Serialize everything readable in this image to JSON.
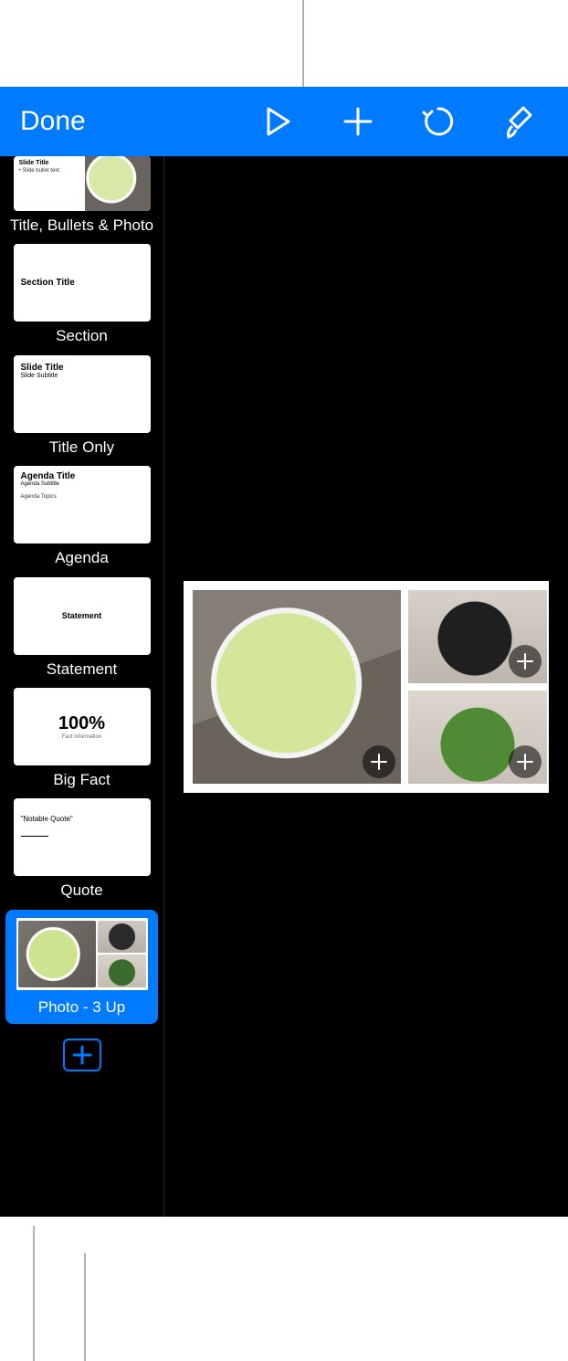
{
  "toolbar": {
    "done_label": "Done",
    "icons": {
      "play": "play-icon",
      "add": "plus-icon",
      "undo": "undo-icon",
      "format": "paintbrush-icon"
    }
  },
  "navigator": {
    "items": [
      {
        "label": "Title, Bullets & Photo",
        "template": "title-bullets-photo",
        "heading": "Slide Title",
        "body": "Slide bullet text"
      },
      {
        "label": "Section",
        "template": "section",
        "heading": "Section Title"
      },
      {
        "label": "Title Only",
        "template": "title-only",
        "heading": "Slide Title",
        "sub": "Slide Subtitle"
      },
      {
        "label": "Agenda",
        "template": "agenda",
        "heading": "Agenda Title",
        "sub": "Agenda Subtitle",
        "body": "Agenda Topics"
      },
      {
        "label": "Statement",
        "template": "statement",
        "heading": "Statement"
      },
      {
        "label": "Big Fact",
        "template": "big-fact",
        "heading": "100%",
        "body": "Fact Information"
      },
      {
        "label": "Quote",
        "template": "quote",
        "heading": "\"Notable Quote\""
      },
      {
        "label": "Photo - 3 Up",
        "template": "photo-3up",
        "selected": true
      }
    ]
  },
  "slide": {
    "layout": "photo-3up",
    "placeholders": 3
  }
}
